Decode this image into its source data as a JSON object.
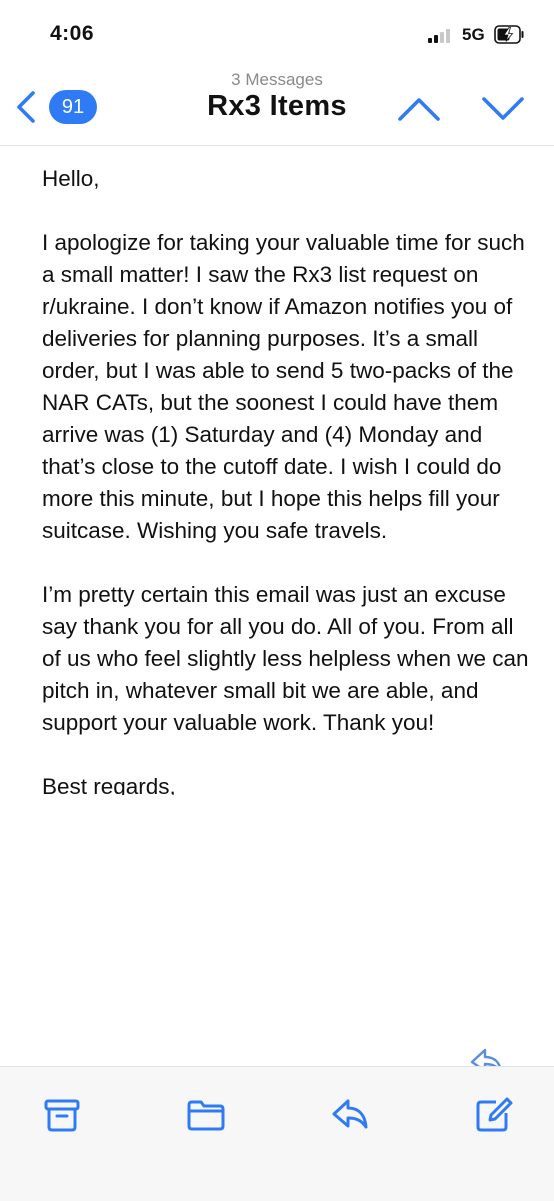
{
  "status_bar": {
    "time": "4:06",
    "network": "5G"
  },
  "nav": {
    "unread_count": "91",
    "message_count": "3 Messages",
    "subject": "Rx3 Items"
  },
  "email": {
    "greeting": "Hello,",
    "paragraph1": "I apologize for taking your valuable time for such a small matter! I saw the Rx3 list request on r/ukraine. I don’t know if Amazon notifies you of deliveries for planning purposes. It’s a small order, but I was able to send 5 two-packs of the NAR CATs, but the soonest I could have them arrive was (1) Saturday and (4) Monday and that’s close to the cutoff date. I wish I could do more this minute, but I hope this helps fill your suitcase. Wishing you safe travels.",
    "paragraph2": "I’m pretty certain this email was just an excuse say thank you for all you do. All of you. From all of us who feel slightly less helpless when we can pitch in, whatever small bit we are able, and support your valuable work. Thank you!",
    "closing": "Best regards,"
  },
  "colors": {
    "accent": "#2f7bf5",
    "text": "#111111",
    "muted": "#8a8a8a"
  },
  "toolbar": {
    "icons": [
      "archive-icon",
      "folder-icon",
      "reply-icon",
      "compose-icon"
    ]
  }
}
